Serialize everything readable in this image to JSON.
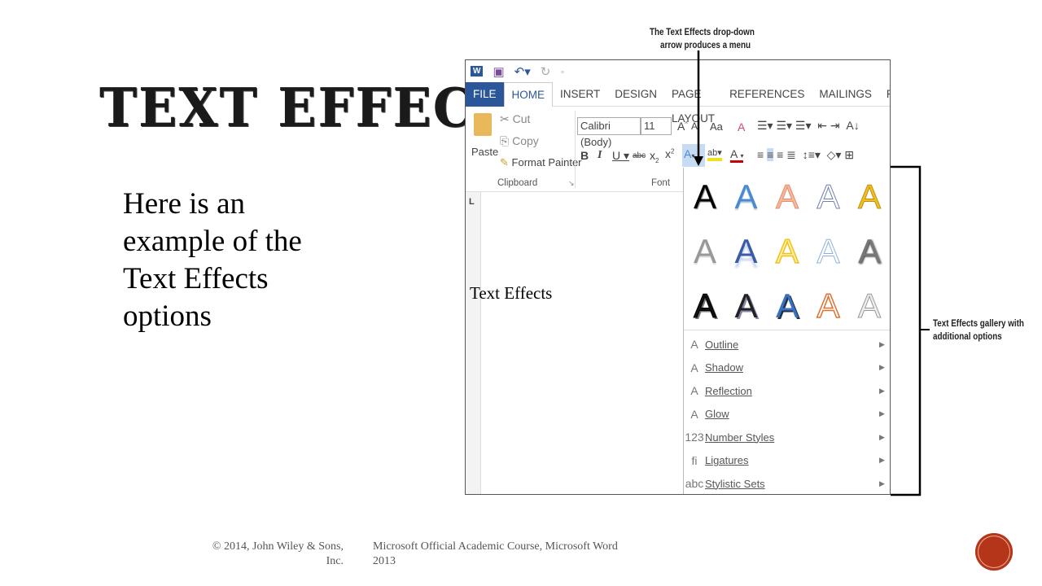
{
  "slide": {
    "title": "TEXT EFFECTS",
    "body": [
      "Here is an",
      "example of the",
      "Text Effects",
      "options"
    ],
    "footer_left": [
      "© 2014, John Wiley & Sons,",
      "Inc."
    ],
    "footer_right": [
      "Microsoft Official Academic Course, Microsoft Word",
      "2013"
    ],
    "accent": "#b5351a"
  },
  "callouts": {
    "top": [
      "The Text Effects drop-down",
      "arrow produces a menu"
    ],
    "right": [
      "Text Effects gallery with",
      "additional options"
    ]
  },
  "word": {
    "tabs": [
      "FILE",
      "HOME",
      "INSERT",
      "DESIGN",
      "PAGE LAYOUT",
      "REFERENCES",
      "MAILINGS",
      "REVIEW"
    ],
    "active_tab": "HOME",
    "clipboard": {
      "paste": "Paste",
      "cut": "Cut",
      "copy": "Copy",
      "format_painter": "Format Painter",
      "label": "Clipboard"
    },
    "font": {
      "name": "Calibri (Body)",
      "size": "11",
      "label": "Font",
      "case": "Aa"
    },
    "document_text": "Text Effects",
    "gallery_letter": "A",
    "menu": [
      {
        "icon": "outline-icon",
        "glyph": "A",
        "label": "Outline"
      },
      {
        "icon": "shadow-icon",
        "glyph": "A",
        "label": "Shadow"
      },
      {
        "icon": "reflection-icon",
        "glyph": "A",
        "label": "Reflection"
      },
      {
        "icon": "glow-icon",
        "glyph": "A",
        "label": "Glow"
      },
      {
        "icon": "number-styles-icon",
        "glyph": "123",
        "label": "Number Styles"
      },
      {
        "icon": "ligatures-icon",
        "glyph": "fi",
        "label": "Ligatures"
      },
      {
        "icon": "stylistic-sets-icon",
        "glyph": "abc",
        "label": "Stylistic Sets"
      }
    ]
  }
}
